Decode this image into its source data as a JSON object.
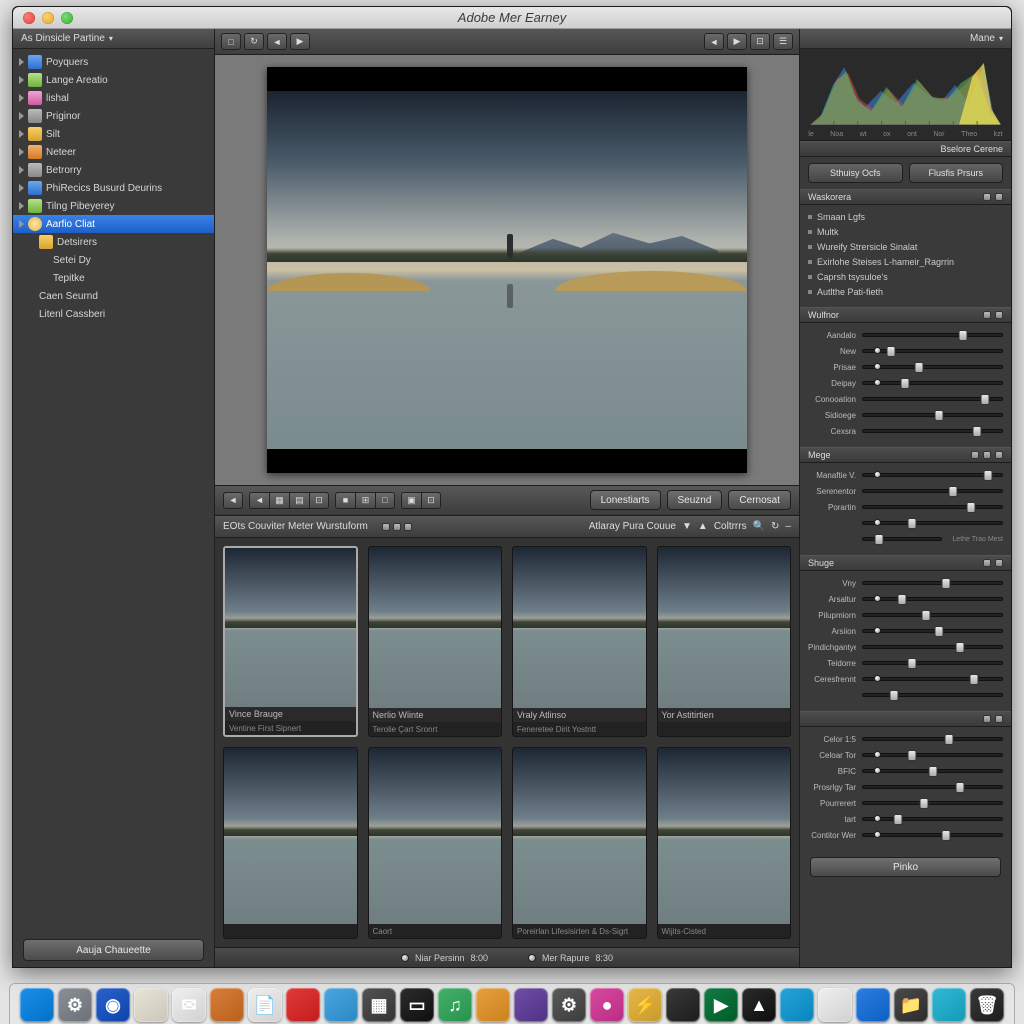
{
  "window": {
    "title": "Adobe Mer Earney"
  },
  "sidebar": {
    "header": "As Dinsicle Partine",
    "items": [
      {
        "label": "Poyquers",
        "icon": "blue"
      },
      {
        "label": "Lange Areatio",
        "icon": "green"
      },
      {
        "label": "lishal",
        "icon": "pink"
      },
      {
        "label": "Priginor",
        "icon": "gray"
      },
      {
        "label": "Silt",
        "icon": "folder"
      },
      {
        "label": "Neteer",
        "icon": "orange"
      },
      {
        "label": "Betrorry",
        "icon": "gray"
      },
      {
        "label": "PhiRecics Busurd Deurins",
        "icon": "blue"
      },
      {
        "label": "Tilng Pibeyerey",
        "icon": "green"
      },
      {
        "label": "Aarfio Cliat",
        "icon": "gold",
        "selected": true
      },
      {
        "label": "Detsirers",
        "icon": "folder",
        "child": true
      },
      {
        "label": "Setei Dy",
        "child2": true
      },
      {
        "label": "Tepitke",
        "child2": true
      },
      {
        "label": "Caen Seurnd",
        "child": true
      },
      {
        "label": "Litenl Cassberi",
        "child": true
      }
    ],
    "bottom_button": "Aauja Chaueette"
  },
  "toolbar_top": {
    "left_buttons": [
      "□",
      "↻",
      "◄",
      "▶"
    ],
    "right_buttons": [
      "◄",
      "▶",
      "⊡",
      "☰"
    ]
  },
  "lower_toolbar": {
    "seg1": [
      "◄",
      "▦",
      "▤",
      "⊡"
    ],
    "seg2": [
      "■",
      "⊞",
      "□"
    ],
    "seg3": [
      "▣",
      "⊡"
    ],
    "right": {
      "btn1": "Lonestiarts",
      "btn2": "Seuznd",
      "btn3": "Cernosat"
    }
  },
  "variations": {
    "header_left": "EOts Couviter Meter Wurstuform",
    "header_right_a": "Atlaray Pura Couue",
    "header_right_b": "Coltrrrs",
    "row1": [
      {
        "label": "Vince Brauge",
        "footer": "Ventine First Sipnert"
      },
      {
        "label": "Nerlio Wiinte",
        "footer": "Terolie Çart Sronrt"
      },
      {
        "label": "Vraly Atlinso",
        "footer": "Feneretee Dirit Yostntt"
      },
      {
        "label": "Yor Astitirtien",
        "footer": ""
      }
    ],
    "row2": [
      {
        "footer": ""
      },
      {
        "footer": "Caort"
      },
      {
        "footer": "Poreirlan Lifesisirten & Ds-Sigrt"
      },
      {
        "footer": "Wijits-Cisted"
      }
    ],
    "footer": {
      "label_a": "Niar Persinn",
      "val_a": "8:00",
      "label_b": "Mer Rapure",
      "val_b": "8:30"
    }
  },
  "right": {
    "header": "Mane",
    "hist_labels": [
      "le",
      "Noa",
      "wt",
      "ox",
      "ont",
      "Nor",
      "Theo",
      "kzt"
    ],
    "hist_title": "Bselore Cerene",
    "tabs": {
      "a": "Sthuisy Ocfs",
      "b": "Flusfis Prsurs"
    },
    "section_a_title": "Waskorera",
    "checklist": [
      "Smaan Lgfs",
      "Multk",
      "Wureify Strersicle Sinalat",
      "Exirlohe Steises L-hameir_Ragrrin",
      "Caprsh tsysuloe's",
      "Autlthe Pati-fieth"
    ],
    "section_b_title": "Wulfnor",
    "sliders_b": [
      {
        "name": "Aandalo",
        "pos": 72
      },
      {
        "name": "New",
        "pos": 20,
        "dot": true
      },
      {
        "name": "Prisae",
        "pos": 40,
        "dot": true
      },
      {
        "name": "Deipay",
        "pos": 30,
        "dot": true
      },
      {
        "name": "Conooation",
        "pos": 88
      },
      {
        "name": "Sidioege",
        "pos": 55
      },
      {
        "name": "Cexsra",
        "pos": 82
      }
    ],
    "section_c_title": "Mege",
    "sliders_c": [
      {
        "name": "Manaftie V.",
        "pos": 90,
        "dot": true
      },
      {
        "name": "Serenentor",
        "pos": 65
      },
      {
        "name": "Porartin",
        "pos": 78
      },
      {
        "name": "",
        "pos": 35,
        "dot": true
      },
      {
        "name": "",
        "pos": 20,
        "note": "Lethe Trao Mest"
      }
    ],
    "section_d_title": "Shuge",
    "sliders_d": [
      {
        "name": "Vny",
        "pos": 60
      },
      {
        "name": "Arsaltur",
        "pos": 28,
        "dot": true
      },
      {
        "name": "Pilupmiorn",
        "pos": 45
      },
      {
        "name": "Arsiion",
        "pos": 55,
        "dot": true
      },
      {
        "name": "Pindichgantye",
        "pos": 70
      },
      {
        "name": "Teidorre",
        "pos": 35
      },
      {
        "name": "Ceresfrennt",
        "pos": 80,
        "dot": true
      },
      {
        "name": "",
        "pos": 22
      }
    ],
    "sliders_e": [
      {
        "name": "Celor 1:5",
        "pos": 62
      },
      {
        "name": "Celoar Tor",
        "pos": 35,
        "dot": true
      },
      {
        "name": "BFIC",
        "pos": 50,
        "dot": true
      },
      {
        "name": "Prosrlgy Tar",
        "pos": 70
      },
      {
        "name": "Pourrerert",
        "pos": 44
      },
      {
        "name": "tart",
        "pos": 25,
        "dot": true
      },
      {
        "name": "Contitor Wer",
        "pos": 60,
        "dot": true
      }
    ],
    "apply_label": "Pinko"
  },
  "dock": [
    {
      "c": "#1e8fe6",
      "t": ""
    },
    {
      "c": "#8a8f96",
      "t": "⚙"
    },
    {
      "c": "#2a62c9",
      "t": "◉"
    },
    {
      "c": "#e9e4d8",
      "t": ""
    },
    {
      "c": "#efefef",
      "t": "✉"
    },
    {
      "c": "#d77e3a",
      "t": ""
    },
    {
      "c": "#efefef",
      "t": "📄"
    },
    {
      "c": "#e03a3a",
      "t": ""
    },
    {
      "c": "#4aa6e0",
      "t": ""
    },
    {
      "c": "#525252",
      "t": "▦"
    },
    {
      "c": "#2c2c2c",
      "t": "▭"
    },
    {
      "c": "#44b06a",
      "t": "♫"
    },
    {
      "c": "#e8a03c",
      "t": ""
    },
    {
      "c": "#6e4fa3",
      "t": ""
    },
    {
      "c": "#5a5a5a",
      "t": "⚙"
    },
    {
      "c": "#d74aa0",
      "t": "●"
    },
    {
      "c": "#e6b84a",
      "t": "⚡"
    },
    {
      "c": "#3a3a3a",
      "t": ""
    },
    {
      "c": "#127a45",
      "t": "▶"
    },
    {
      "c": "#2b2b2b",
      "t": "▲"
    },
    {
      "c": "#26a3d9",
      "t": ""
    },
    {
      "c": "#efefef",
      "t": ""
    },
    {
      "c": "#2b7de0",
      "t": ""
    },
    {
      "c": "#4a4a4a",
      "t": "📁"
    },
    {
      "c": "#30b8d4",
      "t": ""
    },
    {
      "c": "#3a3a3a",
      "t": "🗑"
    }
  ]
}
